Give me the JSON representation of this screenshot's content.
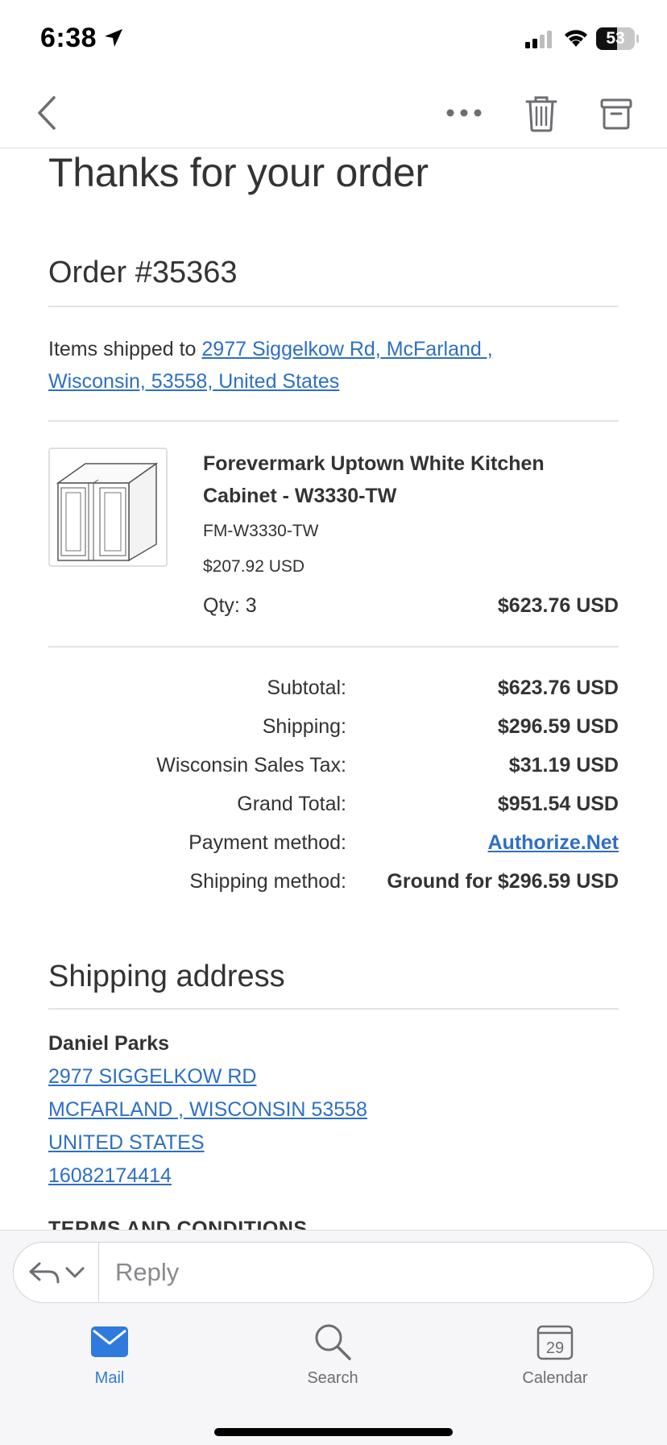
{
  "status_bar": {
    "time": "6:38",
    "battery": "53"
  },
  "email": {
    "title": "Thanks for your order",
    "order_number": "Order #35363",
    "shipped_prefix": "Items shipped to ",
    "shipped_address_line1": "2977 Siggelkow Rd, McFarland ,",
    "shipped_address_line2": "Wisconsin, 53558, United States",
    "product": {
      "name": "Forevermark Uptown White Kitchen Cabinet - W3330-TW",
      "sku": "FM-W3330-TW",
      "price": "$207.92 USD",
      "qty": "Qty: 3",
      "line_total": "$623.76 USD"
    },
    "summary": [
      {
        "label": "Subtotal:",
        "value": "$623.76 USD"
      },
      {
        "label": "Shipping:",
        "value": "$296.59 USD"
      },
      {
        "label": "Wisconsin Sales Tax:",
        "value": "$31.19 USD"
      },
      {
        "label": "Grand Total:",
        "value": "$951.54 USD"
      },
      {
        "label": "Payment method:",
        "value": "Authorize.Net"
      },
      {
        "label": "Shipping method:",
        "value": "Ground for $296.59 USD"
      }
    ],
    "shipping_address": {
      "heading": "Shipping address",
      "name": "Daniel Parks",
      "line1": "2977 SIGGELKOW RD",
      "line2": "MCFARLAND , WISCONSIN 53558",
      "line3": "UNITED STATES",
      "phone": "16082174414"
    },
    "terms_heading": "TERMS AND CONDITIONS"
  },
  "reply": {
    "placeholder": "Reply"
  },
  "tabs": [
    {
      "label": "Mail"
    },
    {
      "label": "Search"
    },
    {
      "label": "Calendar",
      "day": "29"
    }
  ],
  "colors": {
    "link": "#2d6fc5",
    "accent": "#2f7bdd"
  }
}
